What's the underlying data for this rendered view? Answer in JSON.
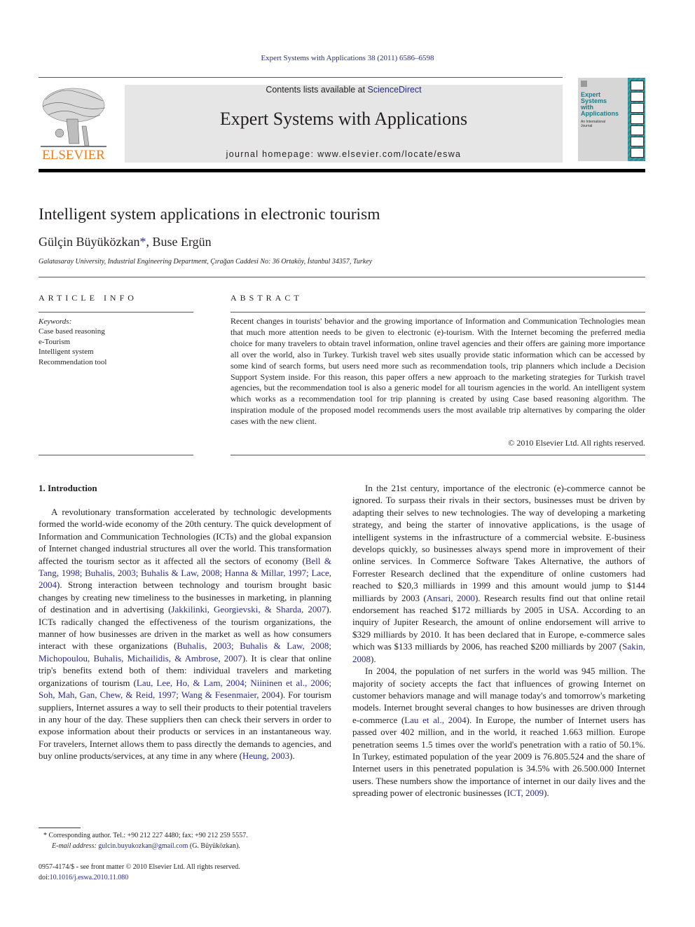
{
  "running_head": "Expert Systems with Applications 38 (2011) 6586–6598",
  "masthead": {
    "publisher": "ELSEVIER",
    "contents_prefix": "Contents lists available at ",
    "contents_link": "ScienceDirect",
    "journal_title": "Expert Systems with Applications",
    "homepage": "journal homepage: www.elsevier.com/locate/eswa",
    "cover_title_lines": [
      "Expert",
      "Systems",
      "with",
      "Applications"
    ],
    "cover_subtitle_lines": [
      "An International",
      "Journal"
    ]
  },
  "article": {
    "title": "Intelligent system applications in electronic tourism",
    "author1": "Gülçin Büyüközkan",
    "author_star": "*",
    "author_sep": ", ",
    "author2": "Buse Ergün",
    "affiliation": "Galatasaray University, Industrial Engineering Department, Çırağan Caddesi No: 36 Ortaköy, İstanbul 34357, Turkey"
  },
  "article_info": {
    "heading": "ARTICLE INFO",
    "keywords_label": "Keywords:",
    "keywords": [
      "Case based reasoning",
      "e-Tourism",
      "Intelligent system",
      "Recommendation tool"
    ]
  },
  "abstract": {
    "heading": "ABSTRACT",
    "text": "Recent changes in tourists' behavior and the growing importance of Information and Communication Technologies mean that much more attention needs to be given to electronic (e)-tourism. With the Internet becoming the preferred media choice for many travelers to obtain travel information, online travel agencies and their offers are gaining more importance all over the world, also in Turkey. Turkish travel web sites usually provide static information which can be accessed by some kind of search forms, but users need more such as recommendation tools, trip planners which include a Decision Support System inside. For this reason, this paper offers a new approach to the marketing strategies for Turkish travel agencies, but the recommendation tool is also a generic model for all tourism agencies in the world. An intelligent system which works as a recommendation tool for trip planning is created by using Case based reasoning algorithm. The inspiration module of the proposed model recommends users the most available trip alternatives by comparing the older cases with the new client.",
    "copyright": "© 2010 Elsevier Ltd. All rights reserved."
  },
  "body": {
    "intro_heading": "1. Introduction",
    "p1": [
      {
        "t": "A revolutionary transformation accelerated by technologic developments formed the world-wide economy of the 20th century. The quick development of Information and Communication Technologies (ICTs) and the global expansion of Internet changed industrial structures all over the world. This transformation affected the tourism sector as it affected all the sectors of economy ("
      },
      {
        "link": "Bell & Tang, 1998; Buhalis, 2003; Buhalis & Law, 2008; Hanna & Millar, 1997; Lace, 2004"
      },
      {
        "t": "). Strong interaction between technology and tourism brought basic changes by creating new timeliness to the businesses in marketing, in planning of destination and in advertising ("
      },
      {
        "link": "Jakkilinki, Georgievski, & Sharda, 2007"
      },
      {
        "t": "). ICTs radically changed the effectiveness of the tourism organizations, the manner of how businesses are driven in the market as well as how consumers interact with these organizations ("
      },
      {
        "link": "Buhalis, 2003; Buhalis & Law, 2008; Michopoulou, Buhalis, Michailidis, & Ambrose, 2007"
      },
      {
        "t": "). It is clear that online trip's benefits extend both of them: individual travelers and marketing organizations of tourism ("
      },
      {
        "link": "Lau, Lee, Ho, & Lam, 2004; Niininen et al., 2006; Soh, Mah, Gan, Chew, & Reid, 1997; Wang & Fesenmaier, 2004"
      },
      {
        "t": "). For tourism suppliers, Internet assures a way to sell their products to their potential travelers in any hour of the day. These suppliers then can check their servers in order to expose information about their products or services in an instantaneous way. For travelers, Internet allows them to pass directly the demands to agencies, and buy online products/services, at any time in any where ("
      },
      {
        "link": "Heung, 2003"
      },
      {
        "t": ")."
      }
    ],
    "p2": [
      {
        "t": "In the 21st century, importance of the electronic (e)-commerce cannot be ignored. To surpass their rivals in their sectors, businesses must be driven by adapting their selves to new technologies. The way of developing a marketing strategy, and being the starter of innovative applications, is the usage of intelligent systems in the infrastructure of a commercial website. E-business develops quickly, so businesses always spend more in improvement of their online services. In Commerce Software Takes Alternative, the authors of Forrester Research declined that the expenditure of online customers had reached to $20,3 milliards in 1999 and this amount would jump to $144 milliards by 2003 ("
      },
      {
        "link": "Ansari, 2000"
      },
      {
        "t": "). Research results find out that online retail endorsement has reached $172 milliards by 2005 in USA. According to an inquiry of Jupiter Research, the amount of online endorsement will arrive to $329 milliards by 2010. It has been declared that in Europe, e-commerce sales which was $133 milliards by 2006, has reached $200 milliards by 2007 ("
      },
      {
        "link": "Sakin, 2008"
      },
      {
        "t": ")."
      }
    ],
    "p3": [
      {
        "t": "In 2004, the population of net surfers in the world was 945 million. The majority of society accepts the fact that influences of growing Internet on customer behaviors manage and will manage today's and tomorrow's marketing models. Internet brought several changes to how businesses are driven through e-commerce ("
      },
      {
        "link": "Lau et al., 2004"
      },
      {
        "t": "). In Europe, the number of Internet users has passed over 402 million, and in the world, it reached 1.663 million. Europe penetration seems 1.5 times over the world's penetration with a ratio of 50.1%. In Turkey, estimated population of the year 2009 is 76.805.524 and the share of Internet users in this penetrated population is 34.5% with 26.500.000 Internet users. These numbers show the importance of internet in our daily lives and the spreading power of electronic businesses ("
      },
      {
        "link": "ICT, 2009"
      },
      {
        "t": ")."
      }
    ]
  },
  "footnote": {
    "star": "*",
    "contact": " Corresponding author. Tel.: +90 212 227 4480; fax: +90 212 259 5557.",
    "email_label": "E-mail address:",
    "email": "gulcin.buyukozkan@gmail.com",
    "email_suffix": " (G. Büyüközkan)."
  },
  "front_matter": {
    "issn_line": "0957-4174/$ - see front matter © 2010 Elsevier Ltd. All rights reserved.",
    "doi_prefix": "doi:",
    "doi": "10.1016/j.eswa.2010.11.080"
  },
  "colors": {
    "link": "#2a2a8c",
    "elsevier_orange": "#f07c1c",
    "band_gray": "#e6e6e6",
    "cover_teal": "#2e8c94"
  }
}
